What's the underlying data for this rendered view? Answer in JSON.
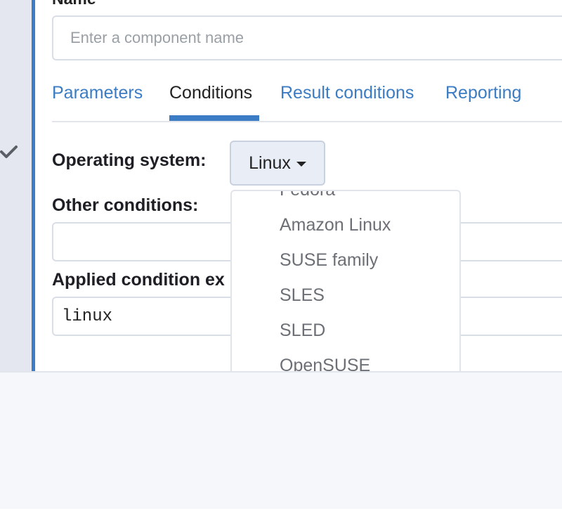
{
  "form": {
    "name_label": "Name",
    "name_placeholder": "Enter a component name"
  },
  "tabs": [
    {
      "label": "Parameters"
    },
    {
      "label": "Conditions"
    },
    {
      "label": "Result conditions"
    },
    {
      "label": "Reporting"
    }
  ],
  "conditions": {
    "os_label": "Operating system:",
    "os_value": "Linux",
    "other_label": "Other conditions:",
    "other_value": "",
    "applied_label": "Applied condition ex",
    "applied_value": "linux"
  },
  "os_menu": {
    "items": [
      "Fedora",
      "Amazon Linux",
      "SUSE family",
      "SLES",
      "SLED",
      "OpenSUSE"
    ]
  },
  "colors": {
    "accent": "#3b7cc4",
    "rail": "#e4e7ef"
  }
}
